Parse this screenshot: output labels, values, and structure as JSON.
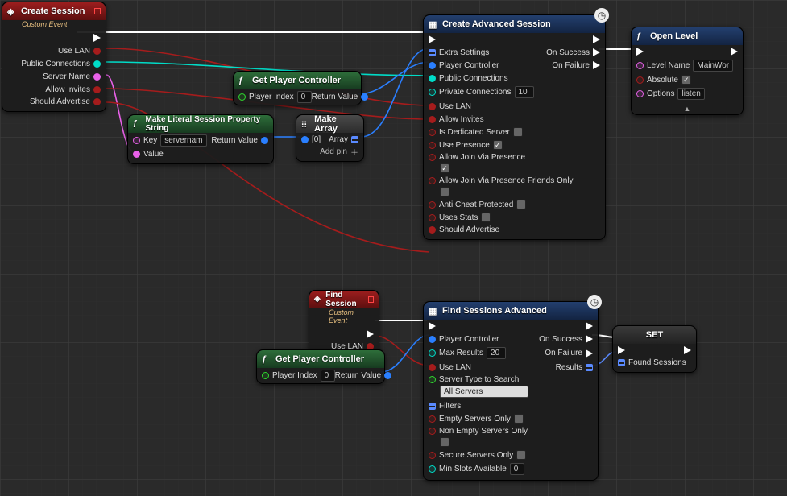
{
  "createSession": {
    "title": "Create Session",
    "subtitle": "Custom Event",
    "pins": {
      "useLan": "Use LAN",
      "publicConnections": "Public Connections",
      "serverName": "Server Name",
      "allowInvites": "Allow Invites",
      "shouldAdvertise": "Should Advertise"
    }
  },
  "makeLiteral": {
    "title": "Make Literal Session Property String",
    "key_label": "Key",
    "key_value": "servername",
    "value_label": "Value",
    "return_label": "Return Value"
  },
  "getPlayerController1": {
    "title": "Get Player Controller",
    "index_label": "Player Index",
    "index_value": "0",
    "return_label": "Return Value"
  },
  "makeArray": {
    "title": "Make Array",
    "input_label": "[0]",
    "output_label": "Array",
    "addpin_label": "Add pin"
  },
  "createAdvanced": {
    "title": "Create Advanced Session",
    "onSuccess": "On Success",
    "onFailure": "On Failure",
    "extraSettings": "Extra Settings",
    "playerController": "Player Controller",
    "publicConnections": "Public Connections",
    "privateConnections": "Private Connections",
    "privateConnections_value": "10",
    "useLan": "Use LAN",
    "allowInvites": "Allow Invites",
    "isDedicated": "Is Dedicated Server",
    "usePresence": "Use Presence",
    "allowJoinViaPresence": "Allow Join Via Presence",
    "allowJoinViaPresenceFriends": "Allow Join Via Presence Friends Only",
    "antiCheat": "Anti Cheat Protected",
    "usesStats": "Uses Stats",
    "shouldAdvertise": "Should Advertise"
  },
  "openLevel": {
    "title": "Open Level",
    "levelName_label": "Level Name",
    "levelName_value": "MainWorld",
    "absolute_label": "Absolute",
    "options_label": "Options",
    "options_value": "listen"
  },
  "findSession": {
    "title": "Find Session",
    "subtitle": "Custom Event",
    "useLan": "Use LAN"
  },
  "getPlayerController2": {
    "title": "Get Player Controller",
    "index_label": "Player Index",
    "index_value": "0",
    "return_label": "Return Value"
  },
  "findAdvanced": {
    "title": "Find Sessions Advanced",
    "onSuccess": "On Success",
    "onFailure": "On Failure",
    "results": "Results",
    "playerController": "Player Controller",
    "maxResults": "Max Results",
    "maxResults_value": "20",
    "useLan": "Use LAN",
    "serverType_label": "Server Type to Search",
    "serverType_value": "All Servers",
    "filters": "Filters",
    "emptyOnly": "Empty Servers Only",
    "nonEmptyOnly": "Non Empty Servers Only",
    "secureOnly": "Secure Servers Only",
    "minSlots": "Min Slots Available",
    "minSlots_value": "0"
  },
  "setNode": {
    "title": "SET",
    "foundSessions": "Found Sessions"
  }
}
